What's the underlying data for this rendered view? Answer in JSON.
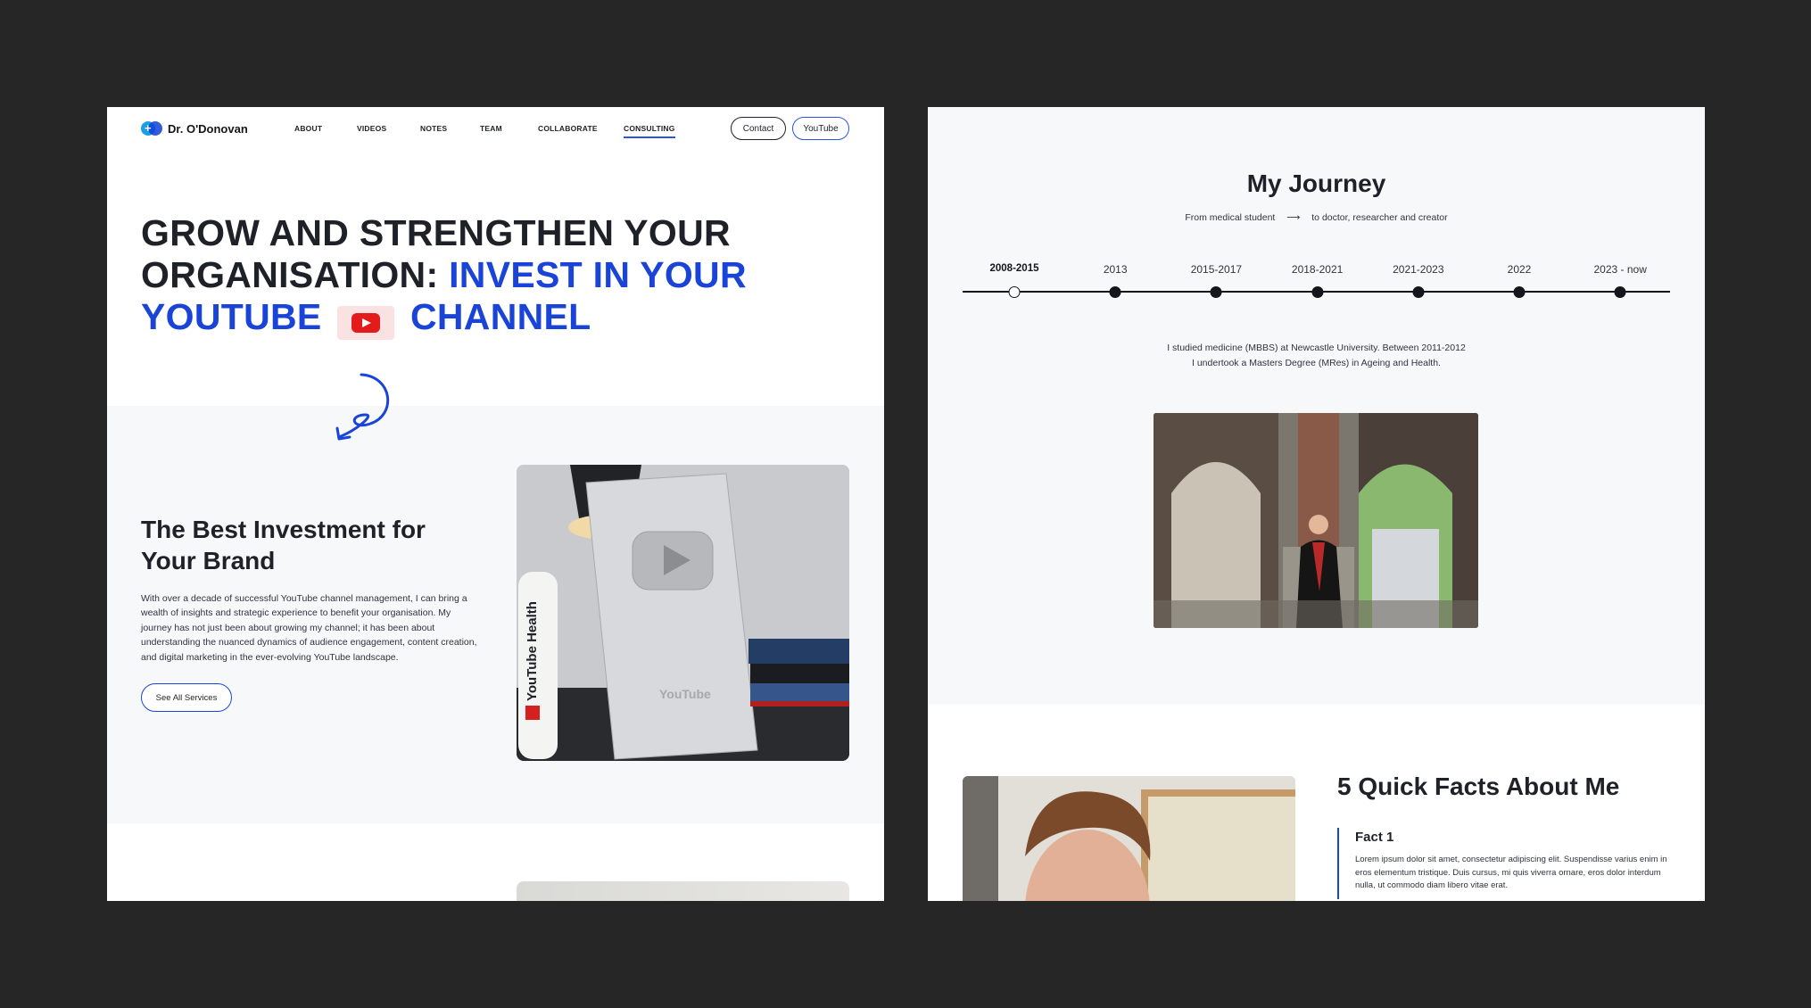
{
  "left": {
    "logo": {
      "text": "Dr. O'Donovan"
    },
    "nav": {
      "items": [
        "ABOUT",
        "VIDEOS",
        "NOTES",
        "TEAM",
        "COLLABORATE",
        "CONSULTING"
      ],
      "active": "CONSULTING",
      "contact_label": "Contact",
      "youtube_label": "YouTube"
    },
    "hero": {
      "line1": "GROW AND STRENGTHEN YOUR",
      "line2_black": "ORGANISATION: ",
      "line2_blue": "INVEST IN YOUR",
      "line3_blue_a": "YOUTUBE",
      "line3_blue_b": "CHANNEL"
    },
    "invest": {
      "title": "The Best Investment for Your Brand",
      "body": "With over a decade of successful YouTube channel management, I can bring a wealth of insights and strategic experience to benefit your organisation. My journey has not just been about growing my channel; it has been about understanding the nuanced dynamics of audience engagement, content creation, and digital marketing in the ever-evolving YouTube landscape.",
      "button": "See All Services"
    },
    "award_photo": {
      "bottle_text": "YouTube Health",
      "plaque_text": "YouTube"
    }
  },
  "right": {
    "journey": {
      "title": "My Journey",
      "sub_left": "From medical student",
      "sub_right": "to doctor, researcher and creator",
      "timeline": [
        "2008-2015",
        "2013",
        "2015-2017",
        "2018-2021",
        "2021-2023",
        "2022",
        "2023 - now"
      ],
      "active_index": 0,
      "text_line1": "I studied medicine (MBBS) at Newcastle University. Between 2011-2012",
      "text_line2": "I undertook a Masters Degree (MRes) in Ageing and Health."
    },
    "facts": {
      "title": "5 Quick Facts About Me",
      "fact1_title": "Fact 1",
      "fact1_text": "Lorem ipsum dolor sit amet, consectetur adipiscing elit. Suspendisse varius enim in eros elementum tristique. Duis cursus, mi quis viverra ornare, eros dolor interdum nulla, ut commodo diam libero vitae erat."
    }
  },
  "colors": {
    "accent": "#1a44d8",
    "youtube_red": "#e41b1b",
    "background": "#262626",
    "band": "#f7f8fa"
  }
}
